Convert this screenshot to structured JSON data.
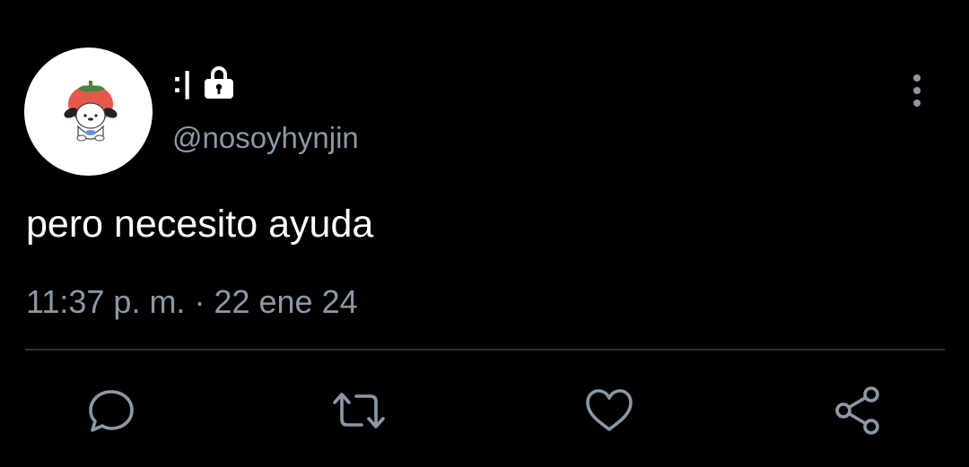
{
  "tweet": {
    "author": {
      "display_name": ":|",
      "handle": "@nosoyhynjin",
      "avatar_icon": "pochacco-tomato-avatar",
      "protected_icon": "lock-icon"
    },
    "text": "pero necesito ayuda",
    "time": "11:37 p. m.",
    "separator": "·",
    "date": "22 ene 24"
  },
  "actions": [
    {
      "name": "reply",
      "icon": "speech-bubble-icon"
    },
    {
      "name": "retweet",
      "icon": "retweet-icon"
    },
    {
      "name": "like",
      "icon": "heart-icon"
    },
    {
      "name": "share",
      "icon": "share-icon"
    }
  ],
  "menu": {
    "icon": "more-vertical-icon"
  },
  "colors": {
    "background": "#000000",
    "primary_text": "#ffffff",
    "secondary_text": "#8b98a5",
    "divider": "#2f3336",
    "icon": "#8b98a5"
  }
}
